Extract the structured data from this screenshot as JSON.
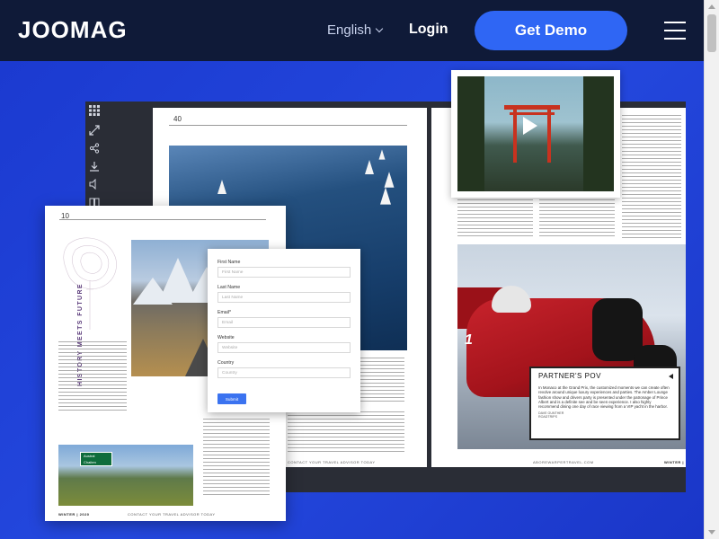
{
  "header": {
    "logo": "JOOMAG",
    "language": "English",
    "login": "Login",
    "demo_button": "Get Demo"
  },
  "colors": {
    "header_bg": "#0f1a38",
    "hero_blue": "#1f40d6",
    "demo_button": "#2f66f4"
  },
  "magazine": {
    "left_page_number": "40",
    "floating_page_number": "10",
    "floating_title": "HISTORY MEETS FUTURE",
    "footer_left": "CONTACT YOUR TRAVEL ADVISOR TODAY",
    "footer_floating": "WINTER | 2020",
    "footer_right_site": "ABOREWARPERTRAVEL.COM",
    "footer_right_issue": "WINTER |",
    "signs": [
      "Austral",
      "Chaiten"
    ],
    "car_number": "1",
    "partner": {
      "title": "PARTNER'S POV",
      "quote": "In Monaco at the Grand Prix, the customized moments we can create often revolve around unique luxury experiences and parties. The Amber Lounge fashion show and drivers party is presented under the patronage of Prince Albert and is a definite see and be seen experience. I also highly recommend dining one day of race viewing from a VIP yacht in the harbor.",
      "author": "DAVE GUNTHER",
      "role": "ROADTRIPS"
    }
  },
  "form": {
    "fields": [
      {
        "label": "First Name",
        "placeholder": "First Name"
      },
      {
        "label": "Last Name",
        "placeholder": "Last Name"
      },
      {
        "label": "Email*",
        "placeholder": "Email"
      },
      {
        "label": "Website",
        "placeholder": "Website"
      },
      {
        "label": "Country",
        "placeholder": "Country"
      }
    ],
    "submit": "Submit"
  },
  "toolbar": {
    "icons": [
      "grid-icon",
      "fullscreen-icon",
      "share-icon",
      "download-icon",
      "sound-icon",
      "book-icon"
    ]
  }
}
